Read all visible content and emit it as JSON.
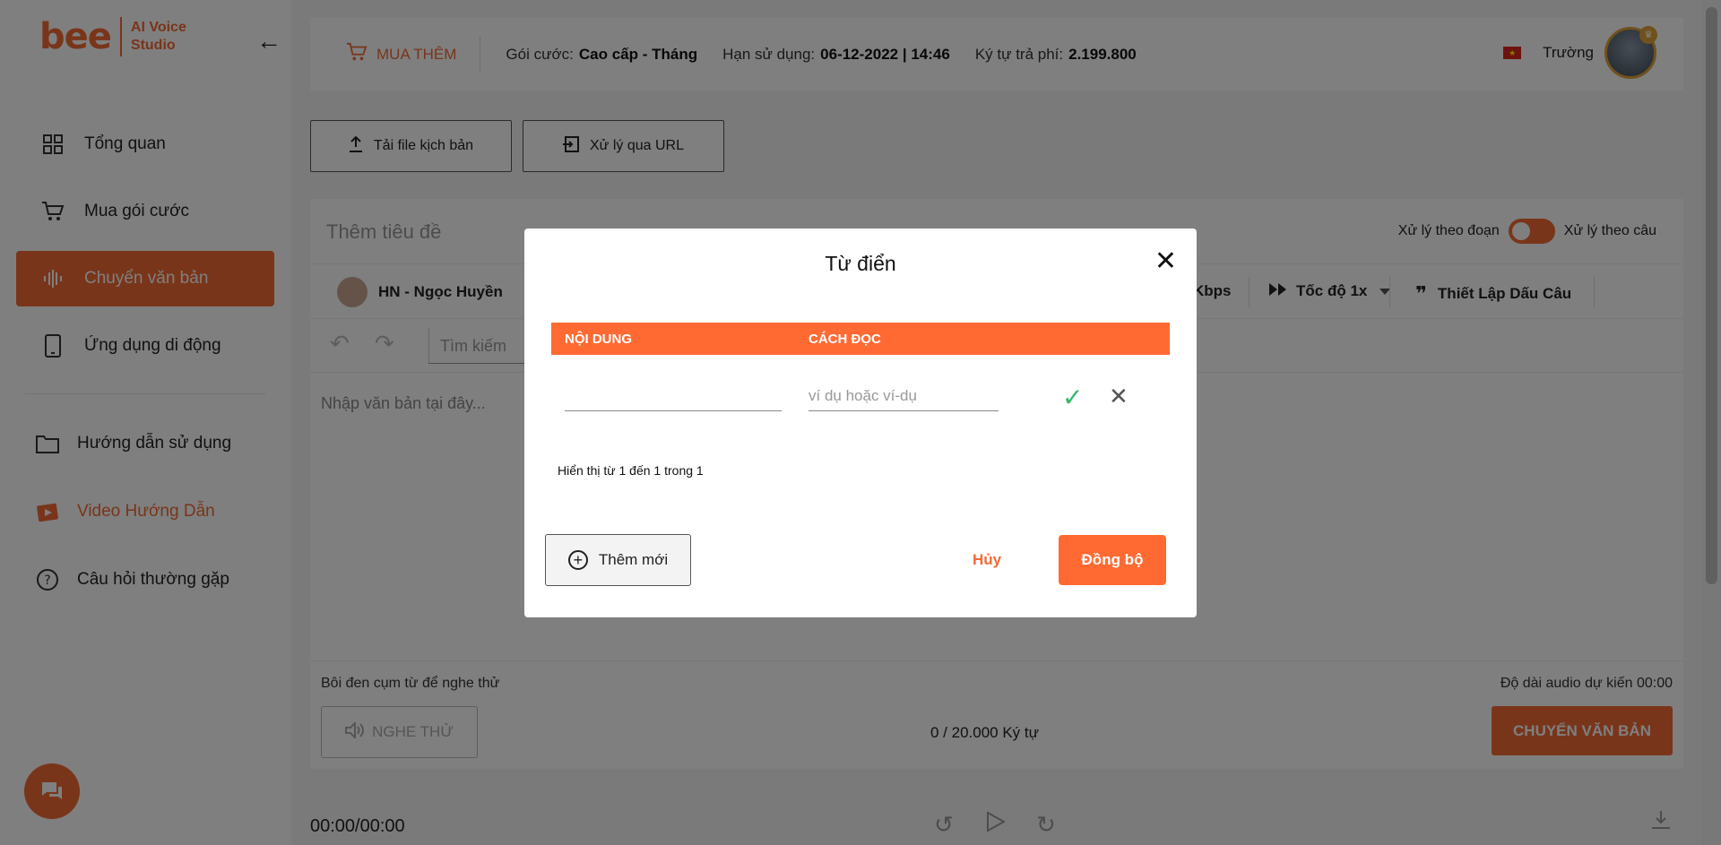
{
  "sidebar": {
    "logo_mark": "bee",
    "logo_line1": "AI Voice",
    "logo_line2": "Studio",
    "items": [
      {
        "label": "Tổng quan",
        "icon": "grid-icon"
      },
      {
        "label": "Mua gói cước",
        "icon": "cart-icon"
      },
      {
        "label": "Chuyển văn bản",
        "icon": "waveform-icon",
        "active": true
      },
      {
        "label": "Ứng dụng di động",
        "icon": "phone-icon"
      }
    ],
    "secondary": [
      {
        "label": "Hướng dẫn sử dụng",
        "icon": "folder-icon"
      },
      {
        "label": "Video Hướng Dẫn",
        "icon": "video-icon"
      },
      {
        "label": "Câu hỏi thường gặp",
        "icon": "question-icon"
      }
    ]
  },
  "topbar": {
    "buy_more": "MUA THÊM",
    "plan_label": "Gói cước:",
    "plan_value": "Cao cấp - Tháng",
    "expiry_label": "Hạn sử dụng:",
    "expiry_value": "06-12-2022 | 14:46",
    "chars_label": "Ký tự trả phí:",
    "chars_value": "2.199.800",
    "user_name": "Trường"
  },
  "upload": {
    "file_label": "Tải file kịch bản",
    "url_label": "Xử lý qua URL"
  },
  "editor": {
    "title_placeholder": "Thêm tiêu đề",
    "toggle_left": "Xử lý theo đoạn",
    "toggle_right": "Xử lý theo câu",
    "voice": "HN - Ngọc Huyền",
    "bitrate": "Kbps",
    "speed": "Tốc độ 1x",
    "punctuation": "Thiết Lập Dấu Câu",
    "search_placeholder": "Tìm kiếm",
    "text_placeholder": "Nhập văn bản tại đây...",
    "hint": "Bôi đen cụm từ để nghe thử",
    "duration": "Độ dài audio dự kiến 00:00",
    "listen": "NGHE THỬ",
    "char_count": "0 / 20.000 Ký tự",
    "convert": "CHUYỂN VĂN BẢN"
  },
  "player": {
    "time": "00:00/00:00"
  },
  "modal": {
    "title": "Từ điển",
    "col_content": "NỘI DUNG",
    "col_reading": "CÁCH ĐỌC",
    "content_value": "",
    "reading_placeholder": "ví dụ hoặc ví-dụ",
    "paging": "Hiển thị từ 1 đến 1 trong 1",
    "add_new": "Thêm mới",
    "cancel": "Hủy",
    "sync": "Đồng bộ"
  },
  "colors": {
    "accent": "#f26a35",
    "table_header": "#ff6a33",
    "confirm": "#2fb66b"
  }
}
